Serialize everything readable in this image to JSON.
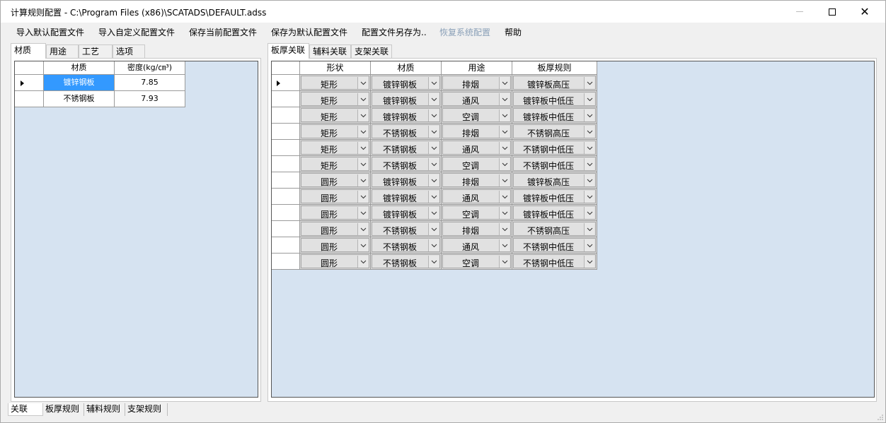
{
  "window": {
    "title": "计算规则配置 - C:\\Program Files (x86)\\SCATADS\\DEFAULT.adss",
    "close_glyph": "✕"
  },
  "menu": [
    {
      "label": "导入默认配置文件",
      "disabled": false
    },
    {
      "label": "导入自定义配置文件",
      "disabled": false
    },
    {
      "label": "保存当前配置文件",
      "disabled": false
    },
    {
      "label": "保存为默认配置文件",
      "disabled": false
    },
    {
      "label": "配置文件另存为..",
      "disabled": false
    },
    {
      "label": "恢复系统配置",
      "disabled": true
    },
    {
      "label": "帮助",
      "disabled": false
    }
  ],
  "left_tabs": [
    "材质",
    "用途",
    "工艺",
    "选项"
  ],
  "left_grid": {
    "headers": [
      "材质",
      "密度(kg/㎝³)"
    ],
    "rows": [
      {
        "material": "镀锌钢板",
        "density": "7.85",
        "selected": true
      },
      {
        "material": "不锈钢板",
        "density": "7.93",
        "selected": false
      }
    ]
  },
  "right_tabs": [
    "板厚关联",
    "辅料关联",
    "支架关联"
  ],
  "right_grid": {
    "headers": [
      "形状",
      "材质",
      "用途",
      "板厚规则"
    ],
    "rows": [
      [
        "矩形",
        "镀锌钢板",
        "排烟",
        "镀锌板高压"
      ],
      [
        "矩形",
        "镀锌钢板",
        "通风",
        "镀锌板中低压"
      ],
      [
        "矩形",
        "镀锌钢板",
        "空调",
        "镀锌板中低压"
      ],
      [
        "矩形",
        "不锈钢板",
        "排烟",
        "不锈钢高压"
      ],
      [
        "矩形",
        "不锈钢板",
        "通风",
        "不锈钢中低压"
      ],
      [
        "矩形",
        "不锈钢板",
        "空调",
        "不锈钢中低压"
      ],
      [
        "圆形",
        "镀锌钢板",
        "排烟",
        "镀锌板高压"
      ],
      [
        "圆形",
        "镀锌钢板",
        "通风",
        "镀锌板中低压"
      ],
      [
        "圆形",
        "镀锌钢板",
        "空调",
        "镀锌板中低压"
      ],
      [
        "圆形",
        "不锈钢板",
        "排烟",
        "不锈钢高压"
      ],
      [
        "圆形",
        "不锈钢板",
        "通风",
        "不锈钢中低压"
      ],
      [
        "圆形",
        "不锈钢板",
        "空调",
        "不锈钢中低压"
      ]
    ]
  },
  "bottom_tabs": [
    "关联",
    "板厚规则",
    "辅料规则",
    "支架规则"
  ],
  "colors": {
    "grid_background": "#d6e3f1",
    "selection": "#3399ff",
    "disabled_menu": "#8aa0b8"
  }
}
